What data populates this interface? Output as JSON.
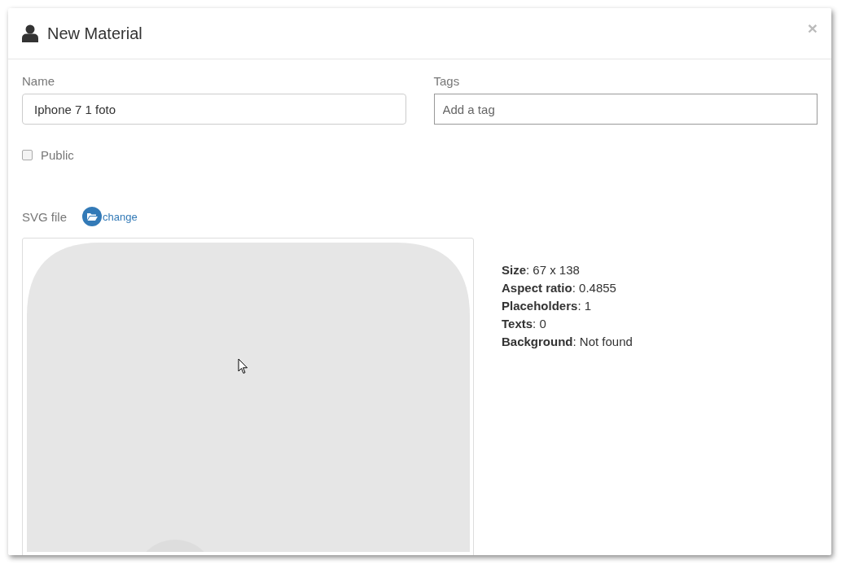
{
  "dialog": {
    "title": "New Material",
    "close": "×"
  },
  "name_field": {
    "label": "Name",
    "value": "Iphone 7 1 foto"
  },
  "tags_field": {
    "label": "Tags",
    "placeholder": "Add a tag"
  },
  "public": {
    "label": "Public",
    "checked": false
  },
  "svg_file": {
    "label": "SVG file",
    "link": "change"
  },
  "stats": [
    "**Size**: 67 x 138",
    "**Aspect ratio**: 0.4855",
    "**Placeholders**: 1",
    "**Texts**: 0",
    "**Background**: Not found"
  ]
}
